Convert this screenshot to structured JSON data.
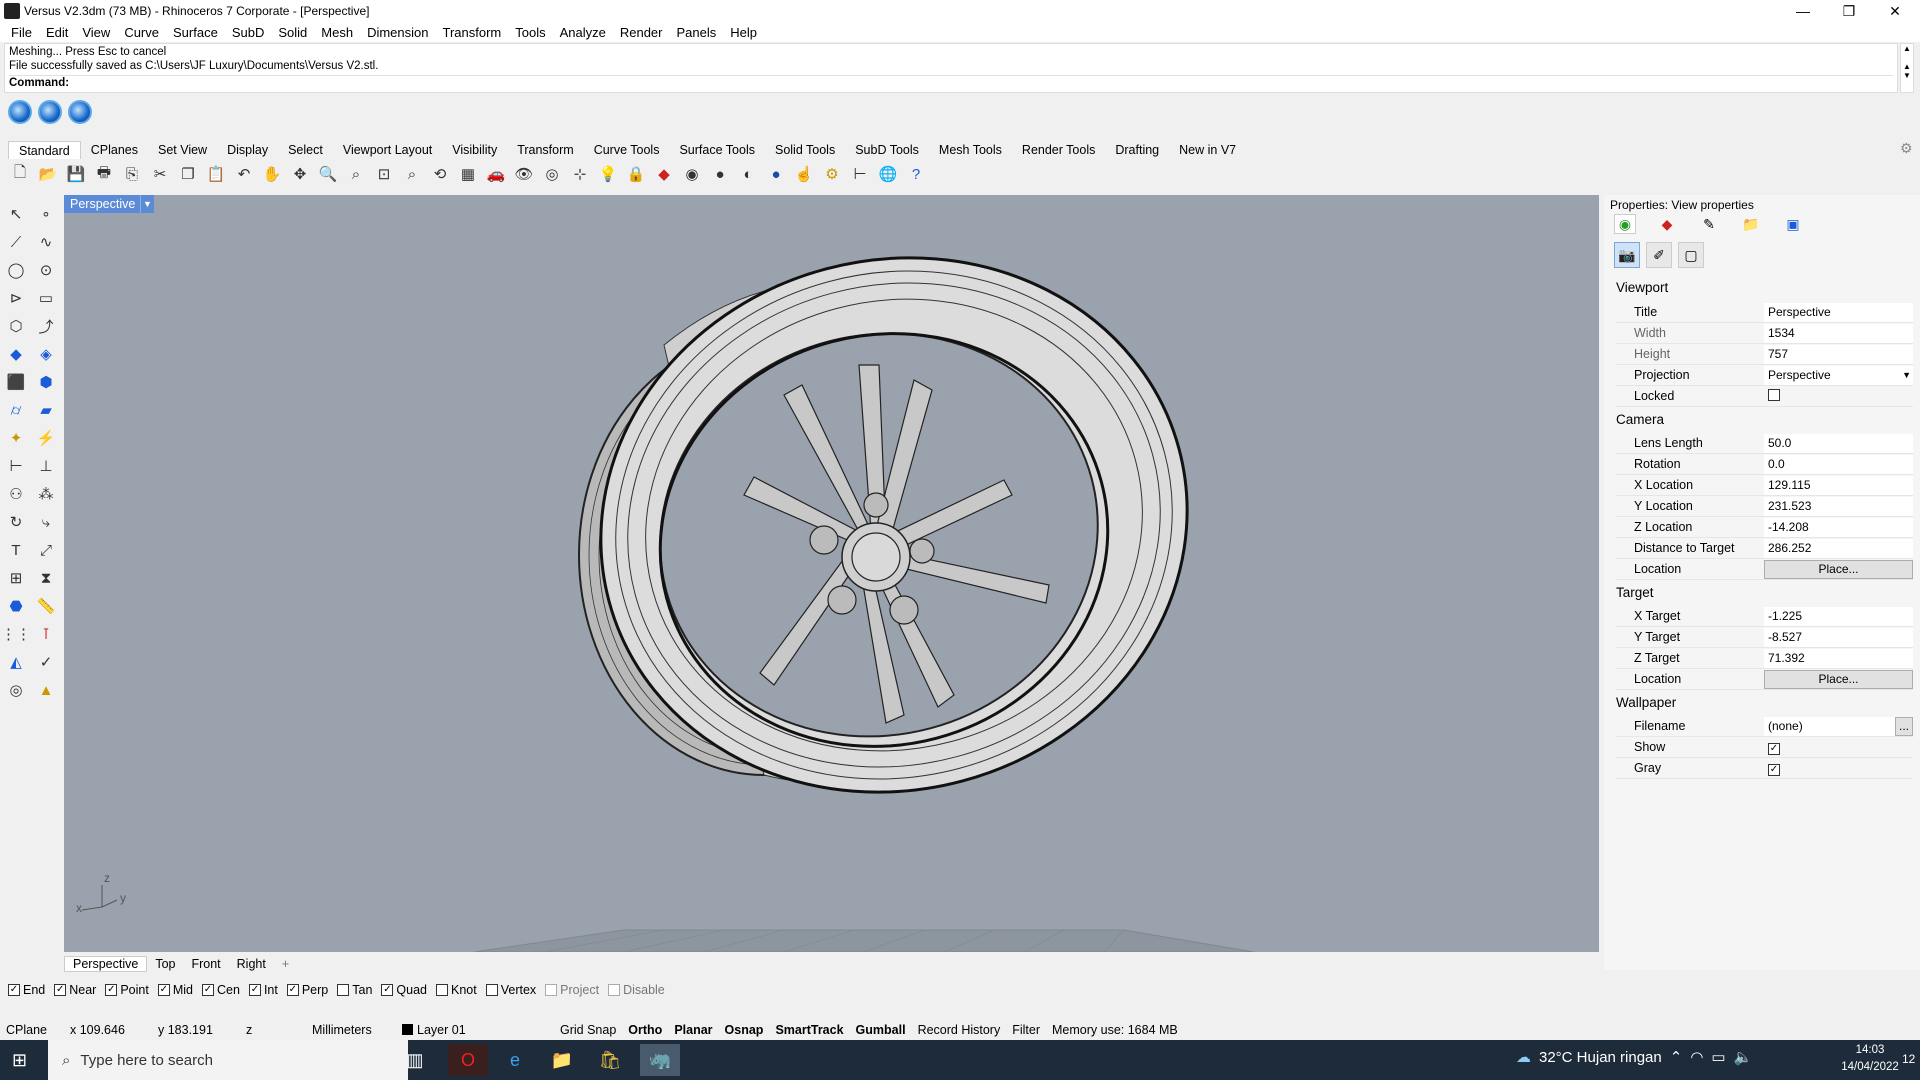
{
  "window": {
    "title": "Versus V2.3dm (73 MB) - Rhinoceros 7 Corporate - [Perspective]",
    "min": "—",
    "max": "❐",
    "close": "✕"
  },
  "menu": [
    "File",
    "Edit",
    "View",
    "Curve",
    "Surface",
    "SubD",
    "Solid",
    "Mesh",
    "Dimension",
    "Transform",
    "Tools",
    "Analyze",
    "Render",
    "Panels",
    "Help"
  ],
  "command": {
    "history1": "Meshing... Press Esc to cancel",
    "history2": "File successfully saved as C:\\Users\\JF Luxury\\Documents\\Versus V2.stl.",
    "prompt": "Command:"
  },
  "toolbar_tabs": [
    "Standard",
    "CPlanes",
    "Set View",
    "Display",
    "Select",
    "Viewport Layout",
    "Visibility",
    "Transform",
    "Curve Tools",
    "Surface Tools",
    "Solid Tools",
    "SubD Tools",
    "Mesh Tools",
    "Render Tools",
    "Drafting",
    "New in V7"
  ],
  "toolbar_icons": [
    "new-file-icon",
    "open-icon",
    "save-icon",
    "print-icon",
    "import-icon",
    "cut-icon",
    "copy-icon",
    "paste-icon",
    "undo-icon",
    "pan-icon",
    "move-view-icon",
    "zoom-icon",
    "zoom-window-icon",
    "zoom-extents-icon",
    "zoom-selected-icon",
    "rotate-view-icon",
    "four-view-icon",
    "car-icon",
    "hide-icon",
    "show-icon",
    "snap-icon",
    "light-icon",
    "lock-icon",
    "materials-icon",
    "color-wheel-icon",
    "sphere-icon",
    "render-sphere-icon",
    "globe-sphere-icon",
    "pointer-icon",
    "gear-options-icon",
    "dimension-icon",
    "world-icon",
    "help-icon"
  ],
  "viewport": {
    "title": "Perspective",
    "axis_x": "x",
    "axis_y": "y",
    "axis_z": "z",
    "tabs": [
      "Perspective",
      "Top",
      "Front",
      "Right"
    ],
    "add_tab": "+"
  },
  "osnap": [
    {
      "label": "End",
      "checked": true,
      "enabled": true
    },
    {
      "label": "Near",
      "checked": true,
      "enabled": true
    },
    {
      "label": "Point",
      "checked": true,
      "enabled": true
    },
    {
      "label": "Mid",
      "checked": true,
      "enabled": true
    },
    {
      "label": "Cen",
      "checked": true,
      "enabled": true
    },
    {
      "label": "Int",
      "checked": true,
      "enabled": true
    },
    {
      "label": "Perp",
      "checked": true,
      "enabled": true
    },
    {
      "label": "Tan",
      "checked": false,
      "enabled": true
    },
    {
      "label": "Quad",
      "checked": true,
      "enabled": true
    },
    {
      "label": "Knot",
      "checked": false,
      "enabled": true
    },
    {
      "label": "Vertex",
      "checked": false,
      "enabled": true
    },
    {
      "label": "Project",
      "checked": false,
      "enabled": false
    },
    {
      "label": "Disable",
      "checked": false,
      "enabled": false
    }
  ],
  "status": {
    "cplane": "CPlane",
    "x": "x 109.646",
    "y": "y 183.191",
    "z": "z",
    "units": "Millimeters",
    "layer": "Layer 01",
    "grid_snap": "Grid Snap",
    "ortho": "Ortho",
    "planar": "Planar",
    "osnap": "Osnap",
    "smarttrack": "SmartTrack",
    "gumball": "Gumball",
    "record_history": "Record History",
    "filter": "Filter",
    "memory": "Memory use: 1684 MB"
  },
  "properties": {
    "panel_title": "Properties: View properties",
    "sections": {
      "viewport": "Viewport",
      "camera": "Camera",
      "target": "Target",
      "wallpaper": "Wallpaper"
    },
    "viewport_rows": [
      {
        "label": "Title",
        "value": "Perspective"
      },
      {
        "label": "Width",
        "value": "1534"
      },
      {
        "label": "Height",
        "value": "757"
      },
      {
        "label": "Projection",
        "value": "Perspective"
      },
      {
        "label": "Locked",
        "value": ""
      }
    ],
    "camera_rows": [
      {
        "label": "Lens Length",
        "value": "50.0"
      },
      {
        "label": "Rotation",
        "value": "0.0"
      },
      {
        "label": "X Location",
        "value": "129.115"
      },
      {
        "label": "Y Location",
        "value": "231.523"
      },
      {
        "label": "Z Location",
        "value": "-14.208"
      },
      {
        "label": "Distance to Target",
        "value": "286.252"
      },
      {
        "label": "Location",
        "value": "Place..."
      }
    ],
    "target_rows": [
      {
        "label": "X Target",
        "value": "-1.225"
      },
      {
        "label": "Y Target",
        "value": "-8.527"
      },
      {
        "label": "Z Target",
        "value": "71.392"
      },
      {
        "label": "Location",
        "value": "Place..."
      }
    ],
    "wallpaper_rows": [
      {
        "label": "Filename",
        "value": "(none)"
      },
      {
        "label": "Show",
        "value": "checked"
      },
      {
        "label": "Gray",
        "value": "checked"
      }
    ],
    "browse": "..."
  },
  "taskbar": {
    "search_placeholder": "Type here to search",
    "weather": "32°C  Hujan ringan",
    "time": "14:03",
    "date": "14/04/2022",
    "notifications": "12"
  },
  "colors": {
    "viewport_bg": "#9aa3ad",
    "viewport_title_bg": "#5b8ad6",
    "taskbar_bg": "#1e2b3a"
  }
}
